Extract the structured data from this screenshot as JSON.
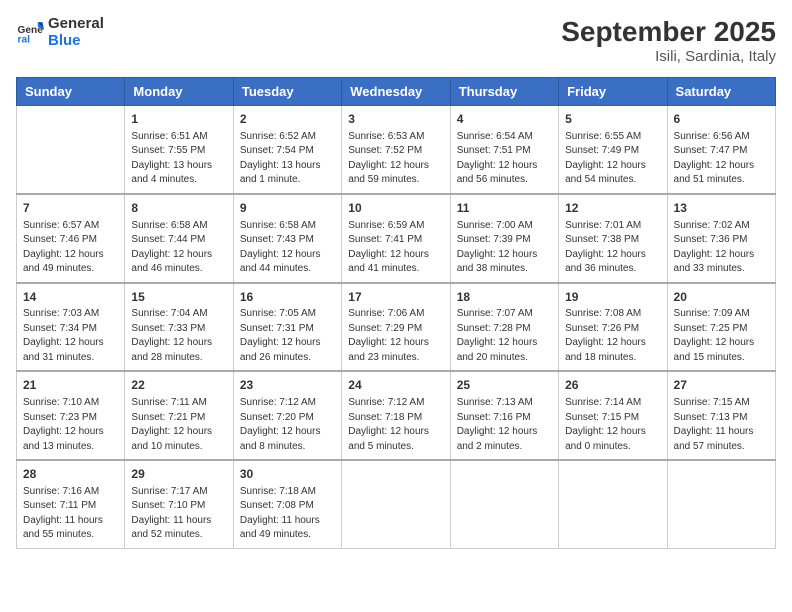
{
  "header": {
    "logo_line1": "General",
    "logo_line2": "Blue",
    "title": "September 2025",
    "subtitle": "Isili, Sardinia, Italy"
  },
  "columns": [
    "Sunday",
    "Monday",
    "Tuesday",
    "Wednesday",
    "Thursday",
    "Friday",
    "Saturday"
  ],
  "weeks": [
    [
      {
        "num": "",
        "info": ""
      },
      {
        "num": "1",
        "info": "Sunrise: 6:51 AM\nSunset: 7:55 PM\nDaylight: 13 hours\nand 4 minutes."
      },
      {
        "num": "2",
        "info": "Sunrise: 6:52 AM\nSunset: 7:54 PM\nDaylight: 13 hours\nand 1 minute."
      },
      {
        "num": "3",
        "info": "Sunrise: 6:53 AM\nSunset: 7:52 PM\nDaylight: 12 hours\nand 59 minutes."
      },
      {
        "num": "4",
        "info": "Sunrise: 6:54 AM\nSunset: 7:51 PM\nDaylight: 12 hours\nand 56 minutes."
      },
      {
        "num": "5",
        "info": "Sunrise: 6:55 AM\nSunset: 7:49 PM\nDaylight: 12 hours\nand 54 minutes."
      },
      {
        "num": "6",
        "info": "Sunrise: 6:56 AM\nSunset: 7:47 PM\nDaylight: 12 hours\nand 51 minutes."
      }
    ],
    [
      {
        "num": "7",
        "info": "Sunrise: 6:57 AM\nSunset: 7:46 PM\nDaylight: 12 hours\nand 49 minutes."
      },
      {
        "num": "8",
        "info": "Sunrise: 6:58 AM\nSunset: 7:44 PM\nDaylight: 12 hours\nand 46 minutes."
      },
      {
        "num": "9",
        "info": "Sunrise: 6:58 AM\nSunset: 7:43 PM\nDaylight: 12 hours\nand 44 minutes."
      },
      {
        "num": "10",
        "info": "Sunrise: 6:59 AM\nSunset: 7:41 PM\nDaylight: 12 hours\nand 41 minutes."
      },
      {
        "num": "11",
        "info": "Sunrise: 7:00 AM\nSunset: 7:39 PM\nDaylight: 12 hours\nand 38 minutes."
      },
      {
        "num": "12",
        "info": "Sunrise: 7:01 AM\nSunset: 7:38 PM\nDaylight: 12 hours\nand 36 minutes."
      },
      {
        "num": "13",
        "info": "Sunrise: 7:02 AM\nSunset: 7:36 PM\nDaylight: 12 hours\nand 33 minutes."
      }
    ],
    [
      {
        "num": "14",
        "info": "Sunrise: 7:03 AM\nSunset: 7:34 PM\nDaylight: 12 hours\nand 31 minutes."
      },
      {
        "num": "15",
        "info": "Sunrise: 7:04 AM\nSunset: 7:33 PM\nDaylight: 12 hours\nand 28 minutes."
      },
      {
        "num": "16",
        "info": "Sunrise: 7:05 AM\nSunset: 7:31 PM\nDaylight: 12 hours\nand 26 minutes."
      },
      {
        "num": "17",
        "info": "Sunrise: 7:06 AM\nSunset: 7:29 PM\nDaylight: 12 hours\nand 23 minutes."
      },
      {
        "num": "18",
        "info": "Sunrise: 7:07 AM\nSunset: 7:28 PM\nDaylight: 12 hours\nand 20 minutes."
      },
      {
        "num": "19",
        "info": "Sunrise: 7:08 AM\nSunset: 7:26 PM\nDaylight: 12 hours\nand 18 minutes."
      },
      {
        "num": "20",
        "info": "Sunrise: 7:09 AM\nSunset: 7:25 PM\nDaylight: 12 hours\nand 15 minutes."
      }
    ],
    [
      {
        "num": "21",
        "info": "Sunrise: 7:10 AM\nSunset: 7:23 PM\nDaylight: 12 hours\nand 13 minutes."
      },
      {
        "num": "22",
        "info": "Sunrise: 7:11 AM\nSunset: 7:21 PM\nDaylight: 12 hours\nand 10 minutes."
      },
      {
        "num": "23",
        "info": "Sunrise: 7:12 AM\nSunset: 7:20 PM\nDaylight: 12 hours\nand 8 minutes."
      },
      {
        "num": "24",
        "info": "Sunrise: 7:12 AM\nSunset: 7:18 PM\nDaylight: 12 hours\nand 5 minutes."
      },
      {
        "num": "25",
        "info": "Sunrise: 7:13 AM\nSunset: 7:16 PM\nDaylight: 12 hours\nand 2 minutes."
      },
      {
        "num": "26",
        "info": "Sunrise: 7:14 AM\nSunset: 7:15 PM\nDaylight: 12 hours\nand 0 minutes."
      },
      {
        "num": "27",
        "info": "Sunrise: 7:15 AM\nSunset: 7:13 PM\nDaylight: 11 hours\nand 57 minutes."
      }
    ],
    [
      {
        "num": "28",
        "info": "Sunrise: 7:16 AM\nSunset: 7:11 PM\nDaylight: 11 hours\nand 55 minutes."
      },
      {
        "num": "29",
        "info": "Sunrise: 7:17 AM\nSunset: 7:10 PM\nDaylight: 11 hours\nand 52 minutes."
      },
      {
        "num": "30",
        "info": "Sunrise: 7:18 AM\nSunset: 7:08 PM\nDaylight: 11 hours\nand 49 minutes."
      },
      {
        "num": "",
        "info": ""
      },
      {
        "num": "",
        "info": ""
      },
      {
        "num": "",
        "info": ""
      },
      {
        "num": "",
        "info": ""
      }
    ]
  ]
}
